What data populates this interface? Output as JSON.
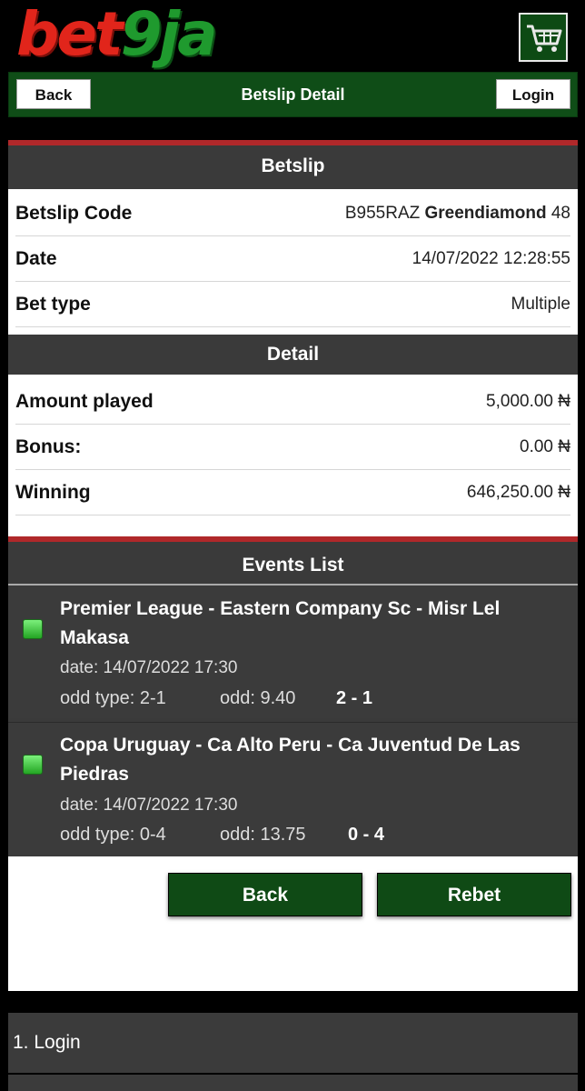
{
  "brand": {
    "logo_part1": "bet",
    "logo_part2": "9",
    "logo_part3": "ja",
    "cart_icon": "cart-icon"
  },
  "topbar": {
    "back_label": "Back",
    "title": "Betslip Detail",
    "login_label": "Login"
  },
  "betslip": {
    "header": "Betslip",
    "code_label": "Betslip Code",
    "code_prefix": "B955RAZ",
    "code_overlay": "Greendiamond",
    "code_suffix": "48",
    "date_label": "Date",
    "date_value": "14/07/2022 12:28:55",
    "bettype_label": "Bet type",
    "bettype_value": "Multiple"
  },
  "detail": {
    "header": "Detail",
    "amount_label": "Amount played",
    "amount_value": "5,000.00 ₦",
    "bonus_label": "Bonus:",
    "bonus_value": "0.00 ₦",
    "winning_label": "Winning",
    "winning_value": "646,250.00 ₦"
  },
  "events": {
    "header": "Events List",
    "items": [
      {
        "title": "Premier League - Eastern Company Sc - Misr Lel Makasa",
        "date": "date: 14/07/2022 17:30",
        "odd_type": "odd type: 2-1",
        "odd": "odd: 9.40",
        "score": "2 - 1",
        "status_color": "#3cc83c"
      },
      {
        "title": "Copa Uruguay - Ca Alto Peru - Ca Juventud De Las Piedras",
        "date": "date: 14/07/2022 17:30",
        "odd_type": "odd type: 0-4",
        "odd": "odd: 13.75",
        "score": "0 - 4",
        "status_color": "#3cc83c"
      }
    ]
  },
  "actions": {
    "back_label": "Back",
    "rebet_label": "Rebet"
  },
  "footer": {
    "item1": "1. Login"
  },
  "colors": {
    "brand_red": "#e1251b",
    "brand_green": "#1f9a2e",
    "bar_green": "#0f4d17",
    "section_dark": "#3a3a3a",
    "accent_red": "#b0282a"
  }
}
